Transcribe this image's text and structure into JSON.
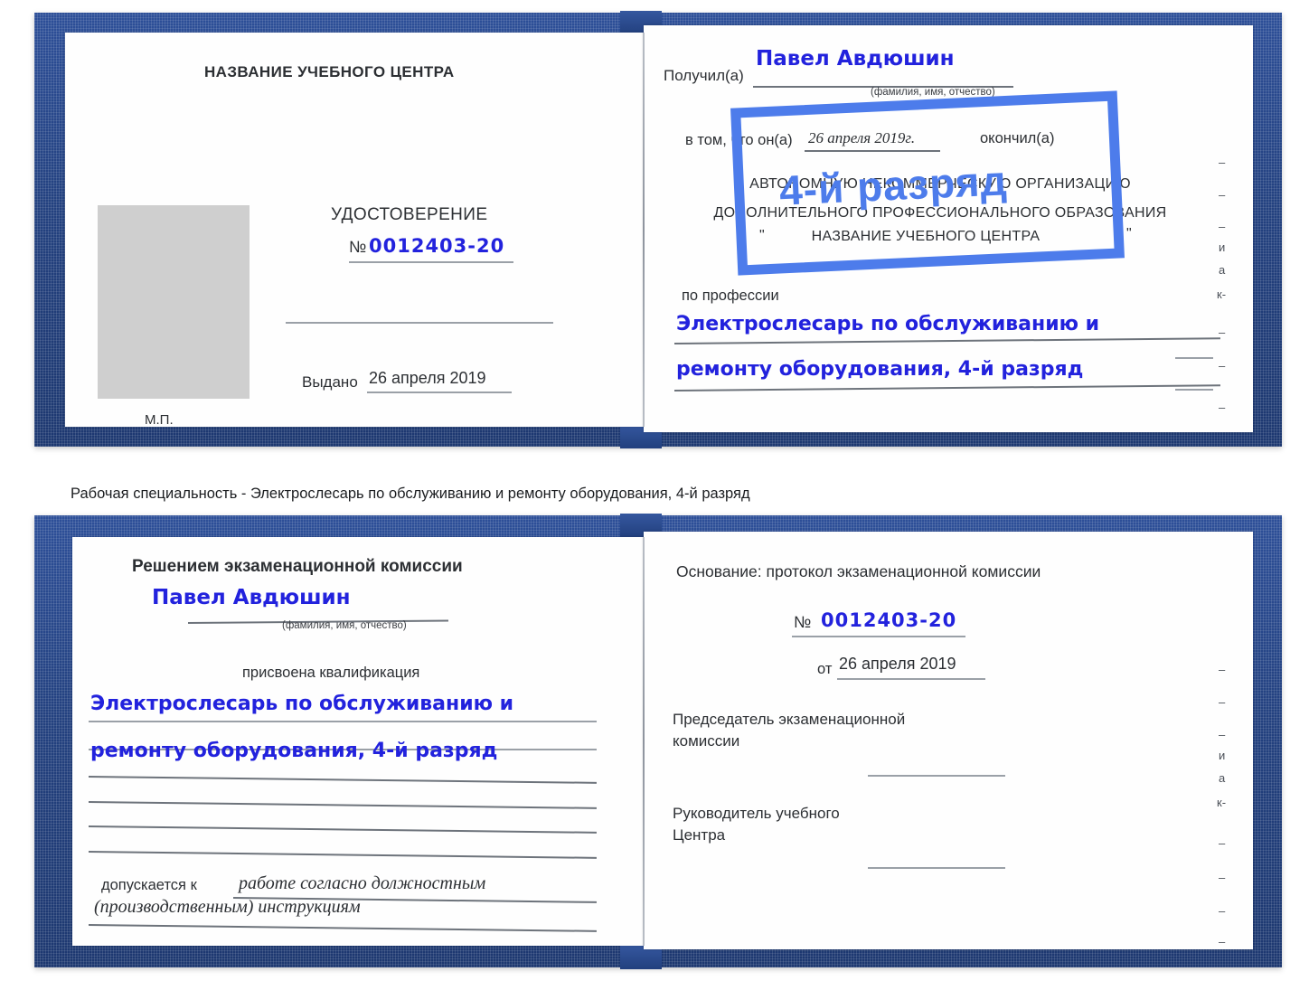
{
  "meta": {
    "accent_blue": "#2d4f98",
    "handwriting_blue": "#2222dd",
    "stamp_blue": "#4d7ceb",
    "paper": "#fefefe"
  },
  "caption": {
    "text": "Рабочая специальность - Электрослесарь по обслуживанию и ремонту оборудования, 4-й разряд"
  },
  "certificate_top": {
    "left_page": {
      "heading": "НАЗВАНИЕ УЧЕБНОГО ЦЕНТРА",
      "doc_title": "УДОСТОВЕРЕНИЕ",
      "number_label": "№",
      "number_value": "0012403-20",
      "issued_label": "Выдано",
      "issued_value": "26 апреля 2019",
      "seal_label": "М.П.",
      "photo_placeholder": "photo-placeholder"
    },
    "right_page": {
      "received_label": "Получил(а)",
      "received_value": "Павел Авдюшин",
      "fio_hint": "(фамилия, имя, отчество)",
      "in_that_label": "в том, что он(а)",
      "in_that_date": "26 апреля 2019г.",
      "finished_label": "окончил(а)",
      "org_line1": "АВТОНОМНУЮ НЕКОММЕРЧЕСКУЮ ОРГАНИЗАЦИЮ",
      "org_line2": "ДОПОЛНИТЕЛЬНОГО ПРОФЕССИОНАЛЬНОГО ОБРАЗОВАНИЯ",
      "org_quote_open": "\"",
      "org_line3": "НАЗВАНИЕ УЧЕБНОГО ЦЕНТРА",
      "org_quote_close": "\"",
      "profession_label": "по профессии",
      "profession_line1": "Электрослесарь по обслуживанию и",
      "profession_line2": "ремонту оборудования, 4-й разряд",
      "stamp_text": "4-й разряд",
      "edge_glyphs": [
        "–",
        "–",
        "–",
        "и",
        "а",
        "к-",
        "–",
        "–",
        "–"
      ]
    }
  },
  "certificate_bottom": {
    "left_page": {
      "heading": "Решением экзаменационной комиссии",
      "name_value": "Павел Авдюшин",
      "fio_hint": "(фамилия, имя, отчество)",
      "qualification_label": "присвоена квалификация",
      "qualification_line1": "Электрослесарь по обслуживанию и",
      "qualification_line2": "ремонту оборудования, 4-й разряд",
      "admitted_label": "допускается к",
      "admitted_line1": "работе согласно должностным",
      "admitted_line2": "(производственным) инструкциям"
    },
    "right_page": {
      "basis_label": "Основание: протокол экзаменационной комиссии",
      "number_label": "№",
      "number_value": "0012403-20",
      "date_label": "от",
      "date_value": "26 апреля 2019",
      "chairman_line1": "Председатель экзаменационной",
      "chairman_line2": "комиссии",
      "head_line1": "Руководитель учебного",
      "head_line2": "Центра",
      "edge_glyphs": [
        "–",
        "–",
        "–",
        "и",
        "а",
        "к-",
        "–",
        "–",
        "–",
        "–"
      ]
    }
  }
}
